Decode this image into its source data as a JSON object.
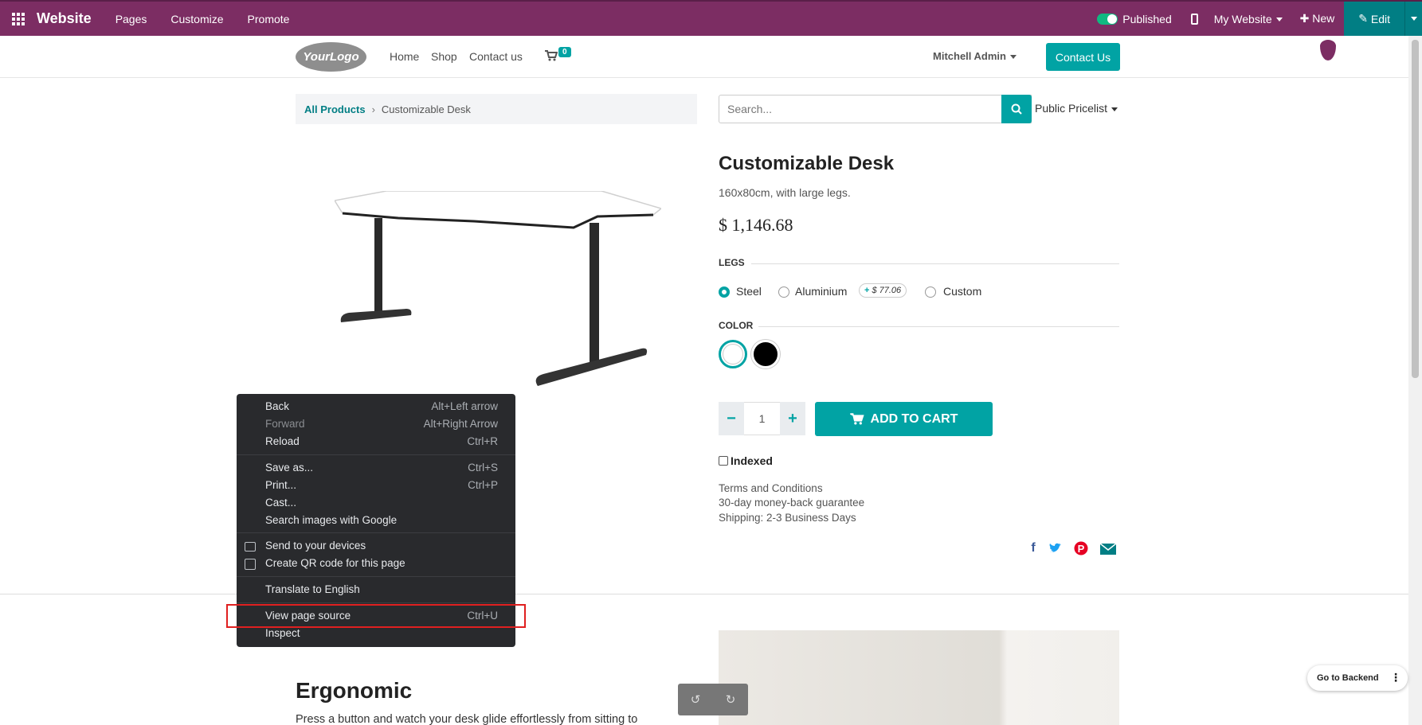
{
  "admin_bar": {
    "brand": "Website",
    "menu": [
      "Pages",
      "Customize",
      "Promote"
    ],
    "published_label": "Published",
    "site_selector": "My Website",
    "new_label": "New",
    "edit_label": "Edit"
  },
  "site_header": {
    "logo_text": "YourLogo",
    "nav": [
      "Home",
      "Shop",
      "Contact us"
    ],
    "cart_count": "0",
    "user": "Mitchell Admin",
    "contact_button": "Contact Us"
  },
  "breadcrumb": {
    "root": "All Products",
    "current": "Customizable Desk"
  },
  "search": {
    "placeholder": "Search...",
    "pricelist": "Public Pricelist"
  },
  "product": {
    "name": "Customizable Desk",
    "description": "160x80cm, with large legs.",
    "price": "$ 1,146.68",
    "legs_title": "LEGS",
    "legs_options": [
      {
        "label": "Steel",
        "checked": true
      },
      {
        "label": "Aluminium",
        "checked": false
      },
      {
        "label": "Custom",
        "checked": false
      }
    ],
    "aluminium_extra": "$ 77.06",
    "color_title": "COLOR",
    "colors": [
      "#ffffff",
      "#000000"
    ],
    "quantity": "1",
    "add_to_cart": "ADD TO CART",
    "indexed_label": "Indexed",
    "terms": [
      "Terms and Conditions",
      "30-day money-back guarantee",
      "Shipping: 2-3 Business Days"
    ]
  },
  "section": {
    "heading": "Ergonomic",
    "paragraph": "Press a button and watch your desk glide effortlessly from sitting to"
  },
  "context_menu": {
    "items": [
      {
        "label": "Back",
        "shortcut": "Alt+Left arrow"
      },
      {
        "label": "Forward",
        "shortcut": "Alt+Right Arrow"
      },
      {
        "label": "Reload",
        "shortcut": "Ctrl+R"
      },
      {
        "label": "Save as...",
        "shortcut": "Ctrl+S"
      },
      {
        "label": "Print...",
        "shortcut": "Ctrl+P"
      },
      {
        "label": "Cast...",
        "shortcut": ""
      },
      {
        "label": "Search images with Google",
        "shortcut": ""
      },
      {
        "label": "Send to your devices",
        "shortcut": ""
      },
      {
        "label": "Create QR code for this page",
        "shortcut": ""
      },
      {
        "label": "Translate to English",
        "shortcut": ""
      },
      {
        "label": "View page source",
        "shortcut": "Ctrl+U"
      },
      {
        "label": "Inspect",
        "shortcut": ""
      }
    ]
  },
  "floating": {
    "go_backend": "Go to Backend"
  },
  "colors": {
    "brand": "#7c2d63",
    "accent": "#01a3a4",
    "edit": "#017e84"
  }
}
